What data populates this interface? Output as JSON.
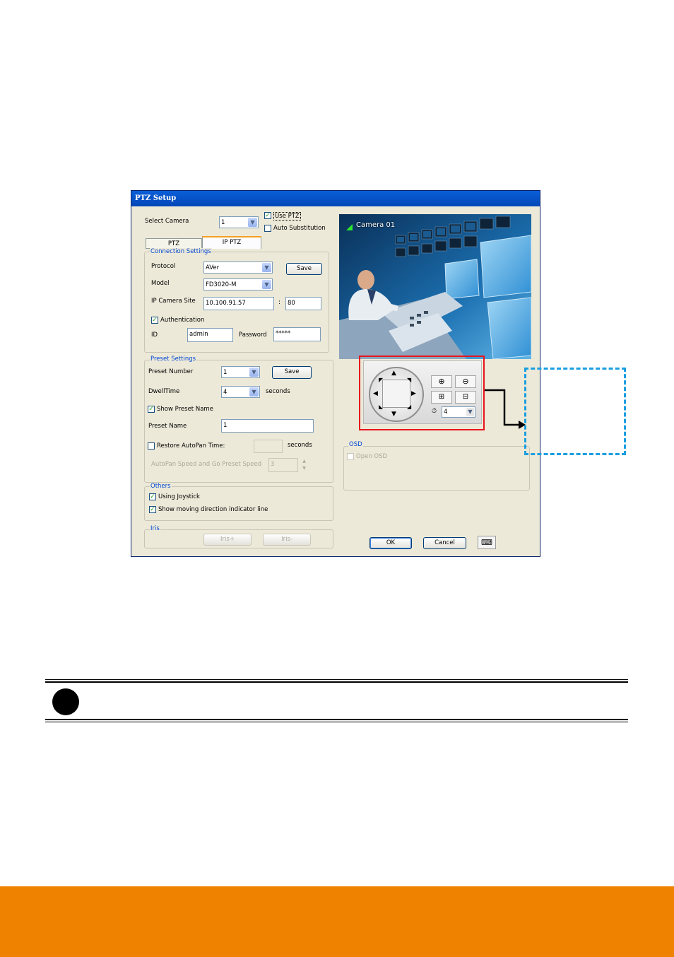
{
  "window": {
    "title": "PTZ Setup",
    "select_camera_label": "Select Camera",
    "select_camera_value": "1",
    "use_ptz_label": "Use PTZ",
    "use_ptz_checked": true,
    "auto_substitution_label": "Auto Substitution",
    "auto_substitution_checked": false,
    "tabs": [
      {
        "label": "PTZ"
      },
      {
        "label": "IP PTZ"
      }
    ],
    "active_tab": "IP PTZ",
    "connection": {
      "title": "Connection Settings",
      "protocol_label": "Protocol",
      "protocol_value": "AVer",
      "save_label": "Save",
      "model_label": "Model",
      "model_value": "FD3020-M",
      "site_label": "IP Camera Site",
      "site_value": "10.100.91.57",
      "port_sep": ":",
      "port_value": "80",
      "auth_label": "Authentication",
      "auth_checked": true,
      "id_label": "ID",
      "id_value": "admin",
      "password_label": "Password",
      "password_value": "*****"
    },
    "preset": {
      "title": "Preset Settings",
      "number_label": "Preset Number",
      "number_value": "1",
      "save_label": "Save",
      "dwell_label": "DwellTime",
      "dwell_value": "4",
      "dwell_unit": "seconds",
      "show_name_label": "Show Preset Name",
      "show_name_checked": true,
      "name_label": "Preset Name",
      "name_value": "1",
      "restore_label": "Restore AutoPan Time:",
      "restore_checked": false,
      "restore_value": "",
      "restore_unit": "seconds",
      "speed_label": "AutoPan Speed and Go Preset Speed",
      "speed_value": "3"
    },
    "others": {
      "title": "Others",
      "joystick_label": "Using Joystick",
      "joystick_checked": true,
      "indicator_label": "Show moving direction indicator line",
      "indicator_checked": true
    },
    "iris": {
      "title": "Iris",
      "plus_label": "Iris+",
      "minus_label": "Iris-"
    },
    "preview": {
      "camera_label": "Camera 01"
    },
    "ptz_control": {
      "speed_value": "4"
    },
    "osd": {
      "title": "OSD",
      "open_label": "Open OSD",
      "open_checked": false
    },
    "ok_label": "OK",
    "cancel_label": "Cancel"
  },
  "colors": {
    "highlight_box": "#e8141c",
    "callout_border": "#1a9ee0",
    "footer_bar": "#ef8300",
    "group_title": "#0046d5"
  }
}
